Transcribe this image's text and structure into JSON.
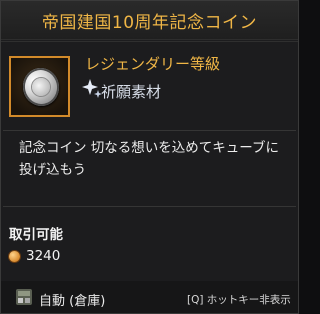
{
  "title": "帝国建国10周年記念コイン",
  "grade": "レジェンダリー等級",
  "category": "祈願素材",
  "description": "記念コイン 切なる想いを込めてキューブに投げ込もう",
  "tradable_label": "取引可能",
  "price": "3240",
  "footer": {
    "auto_label": "自動 (倉庫)",
    "hotkey_label": "[Q] ホットキー非表示"
  },
  "icons": {
    "item": "silver-coin-icon",
    "category": "sparkle-icon",
    "price": "gold-coin-icon",
    "storage": "warehouse-icon"
  },
  "colors": {
    "title": "#f0b646",
    "grade": "#f0b646",
    "slot_border": "#d28a2a",
    "background": "#1c1c1e"
  }
}
